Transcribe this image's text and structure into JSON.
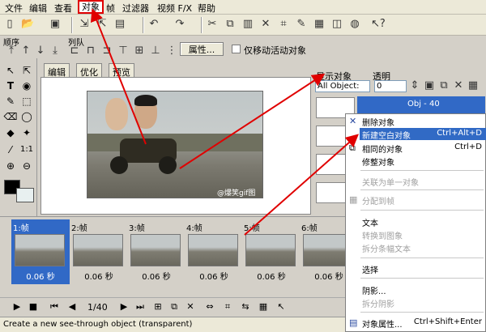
{
  "menubar": {
    "items": [
      "文件",
      "编辑",
      "查看",
      "对象",
      "帧",
      "过滤器",
      "视频 F/X",
      "帮助"
    ]
  },
  "toolbar2": {
    "order_label": "顺序",
    "align_label": "列队",
    "properties_button": "属性...",
    "move_active_only": "仅移动活动对象"
  },
  "tabs": [
    "编辑",
    "优化",
    "预览"
  ],
  "canvas": {
    "watermark": "@爆笑gif图"
  },
  "rpanel": {
    "display_label": "显示对象",
    "transparency_label": "透明",
    "display_combo": "All Object:",
    "transparency_value": "0",
    "selected_object": "Obj - 40"
  },
  "context_menu": {
    "items": [
      {
        "label": "删除对象",
        "shortcut": ""
      },
      {
        "label": "新建空白对象",
        "shortcut": "Ctrl+Alt+D"
      },
      {
        "label": "相同的对象",
        "shortcut": "Ctrl+D"
      },
      {
        "label": "修整对象",
        "shortcut": ""
      },
      {
        "label": "关联为单一对象",
        "shortcut": ""
      },
      {
        "label": "分配到帧",
        "shortcut": ""
      },
      {
        "label": "文本",
        "shortcut": ""
      },
      {
        "label": "转换到图象",
        "shortcut": ""
      },
      {
        "label": "拆分条幅文本",
        "shortcut": ""
      },
      {
        "label": "选择",
        "shortcut": ""
      },
      {
        "label": "阴影...",
        "shortcut": ""
      },
      {
        "label": "拆分阴影",
        "shortcut": ""
      },
      {
        "label": "对象属性...",
        "shortcut": "Ctrl+Shift+Enter"
      }
    ]
  },
  "frames": [
    {
      "label": "1:帧",
      "time": "0.06 秒"
    },
    {
      "label": "2:帧",
      "time": "0.06 秒"
    },
    {
      "label": "3:帧",
      "time": "0.06 秒"
    },
    {
      "label": "4:帧",
      "time": "0.06 秒"
    },
    {
      "label": "5:帧",
      "time": "0.06 秒"
    },
    {
      "label": "6:帧",
      "time": "0.06 秒"
    }
  ],
  "playbar": {
    "frame_counter": "1/40"
  },
  "statusbar": {
    "text": "Create a new see-through object (transparent)"
  },
  "colors": {
    "highlight": "#316ac5",
    "annotation_red": "#e00000"
  }
}
